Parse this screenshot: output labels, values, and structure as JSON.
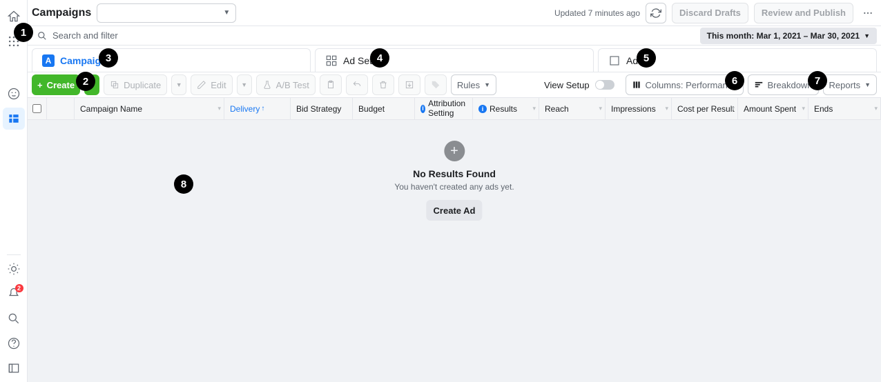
{
  "header": {
    "title": "Campaigns",
    "account_placeholder": " ",
    "updated": "Updated 7 minutes ago",
    "discard": "Discard Drafts",
    "review": "Review and Publish"
  },
  "search": {
    "placeholder": "Search and filter",
    "date_range": "This month: Mar 1, 2021 – Mar 30, 2021"
  },
  "tabs": {
    "campaigns": "Campaigns",
    "adsets": "Ad Sets",
    "ads": "Ads"
  },
  "toolbar": {
    "create": "Create",
    "duplicate": "Duplicate",
    "edit": "Edit",
    "abtest": "A/B Test",
    "rules": "Rules",
    "view_setup": "View Setup",
    "columns": "Columns: Performance",
    "breakdown": "Breakdown",
    "reports": "Reports"
  },
  "columns": {
    "name": "Campaign Name",
    "delivery": "Delivery",
    "bid": "Bid Strategy",
    "budget": "Budget",
    "attr": "Attribution Setting",
    "results": "Results",
    "reach": "Reach",
    "impressions": "Impressions",
    "cpr": "Cost per Result",
    "spent": "Amount Spent",
    "ends": "Ends"
  },
  "empty": {
    "title": "No Results Found",
    "subtitle": "You haven't created any ads yet.",
    "cta": "Create Ad"
  },
  "sidebar": {
    "notif_count": "2"
  }
}
